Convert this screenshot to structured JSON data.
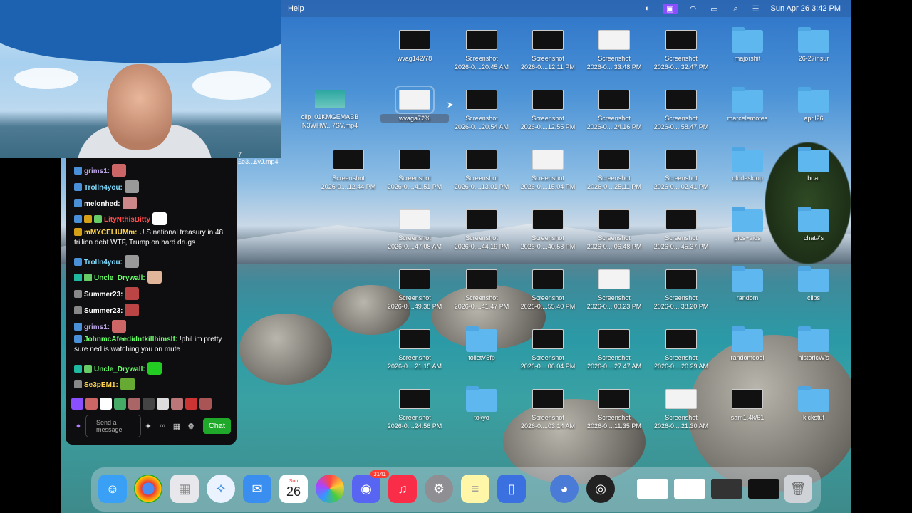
{
  "menubar": {
    "help": "Help",
    "datetime": "Sun Apr 26  3:42 PM"
  },
  "chat": {
    "messages": [
      {
        "user": "grims1:",
        "color": "#b9a3e3",
        "text": ""
      },
      {
        "user": "Trolln4you:",
        "color": "#7fdcff",
        "text": ""
      },
      {
        "user": "melonhed:",
        "color": "#ffffff",
        "text": ""
      },
      {
        "user": "LityNthisBitty",
        "color": "#ff4d4d",
        "text": ""
      },
      {
        "user": "mMYCELIUMm:",
        "color": "#ffd54d",
        "text": "U.S national treasury in 48 trillion debt WTF, Trump on hard drugs"
      },
      {
        "user": "Trolln4you:",
        "color": "#7fdcff",
        "text": ""
      },
      {
        "user": "Uncle_Drywall:",
        "color": "#6cff6c",
        "text": ""
      },
      {
        "user": "Summer23:",
        "color": "#ffffff",
        "text": ""
      },
      {
        "user": "Summer23:",
        "color": "#ffffff",
        "text": ""
      },
      {
        "user": "grims1:",
        "color": "#b9a3e3",
        "text": ""
      },
      {
        "user": "JohnmcAfeedidntkillhimslf:",
        "color": "#6cff6c",
        "text": "!phil im pretty sure ned is watching you on mute"
      },
      {
        "user": "Uncle_Drywall:",
        "color": "#6cff6c",
        "text": ""
      },
      {
        "user": "Se3pEM1:",
        "color": "#ffd54d",
        "text": ""
      }
    ],
    "placeholder": "Send a message",
    "chat_button": "Chat"
  },
  "cam_label": "7\n£e3...£vJ.mp4",
  "desktop_icons": [
    {
      "label": "wvag142/78",
      "type": "thumb"
    },
    {
      "label": "Screenshot\n2026-0....20.45 AM",
      "type": "thumb"
    },
    {
      "label": "Screenshot\n2026-0....12.11 PM",
      "type": "thumb"
    },
    {
      "label": "Screenshot\n2026-0....33.48 PM",
      "type": "thumb"
    },
    {
      "label": "Screenshot\n2026-0....32.47 PM",
      "type": "thumb"
    },
    {
      "label": "majorshit",
      "type": "folder"
    },
    {
      "label": "26-27insur",
      "type": "folder"
    },
    {
      "label": "clip_01KMGEMABB\nN3WHW...7SV.mp4",
      "type": "thumb"
    },
    {
      "label": "wvaga72%",
      "type": "thumb"
    },
    {
      "label": "Screenshot\n2026-0....20.54 AM",
      "type": "thumb"
    },
    {
      "label": "Screenshot\n2026-0....12.55 PM",
      "type": "thumb"
    },
    {
      "label": "Screenshot\n2026-0....24.16 PM",
      "type": "thumb"
    },
    {
      "label": "Screenshot\n2026-0....58.47 PM",
      "type": "thumb"
    },
    {
      "label": "marcelemotes",
      "type": "folder"
    },
    {
      "label": "april26",
      "type": "folder"
    },
    {
      "label": "Screenshot\n2026-0....12.44 PM",
      "type": "thumb"
    },
    {
      "label": "Screenshot\n2026-0....41.51 PM",
      "type": "thumb"
    },
    {
      "label": "Screenshot\n2026-0....13.01 PM",
      "type": "thumb"
    },
    {
      "label": "Screenshot\n2026-0....15.04 PM",
      "type": "thumb"
    },
    {
      "label": "Screenshot\n2026-0....25.11 PM",
      "type": "thumb"
    },
    {
      "label": "Screenshot\n2026-0....02.41 PM",
      "type": "thumb"
    },
    {
      "label": "olddesktop",
      "type": "folder"
    },
    {
      "label": "boat",
      "type": "folder"
    },
    {
      "label": "Screenshot\n2026-0....47.08 AM",
      "type": "thumb"
    },
    {
      "label": "Screenshot\n2026-0....44.19 PM",
      "type": "thumb"
    },
    {
      "label": "Screenshot\n2026-0....40.58 PM",
      "type": "thumb"
    },
    {
      "label": "Screenshot\n2026-0....06.48 PM",
      "type": "thumb"
    },
    {
      "label": "Screenshot\n2026-0....45.37 PM",
      "type": "thumb"
    },
    {
      "label": "pics+vids",
      "type": "folder"
    },
    {
      "label": "chat#'s",
      "type": "folder"
    },
    {
      "label": "Screenshot\n2026-0....49.38 PM",
      "type": "thumb"
    },
    {
      "label": "Screenshot\n2026-0....41.47 PM",
      "type": "thumb"
    },
    {
      "label": "Screenshot\n2026-0....55.40 PM",
      "type": "thumb"
    },
    {
      "label": "Screenshot\n2026-0....00.23 PM",
      "type": "thumb"
    },
    {
      "label": "Screenshot\n2026-0....38.20 PM",
      "type": "thumb"
    },
    {
      "label": "random",
      "type": "folder"
    },
    {
      "label": "clips",
      "type": "folder"
    },
    {
      "label": "Screenshot\n2026-0....21.15 AM",
      "type": "thumb"
    },
    {
      "label": "toiletV5fp",
      "type": "folder"
    },
    {
      "label": "Screenshot\n2026-0....06.04 PM",
      "type": "thumb"
    },
    {
      "label": "Screenshot\n2026-0....27.47 AM",
      "type": "thumb"
    },
    {
      "label": "Screenshot\n2026-0....20.29 AM",
      "type": "thumb"
    },
    {
      "label": "randomcool",
      "type": "folder"
    },
    {
      "label": "historicW's",
      "type": "folder"
    },
    {
      "label": "Screenshot\n2026-0....24.56 PM",
      "type": "thumb"
    },
    {
      "label": "tokyo",
      "type": "folder"
    },
    {
      "label": "Screenshot\n2026-0....03.14 AM",
      "type": "thumb"
    },
    {
      "label": "Screenshot\n2026-0....11.35 PM",
      "type": "thumb"
    },
    {
      "label": "Screenshot\n2026-0....21.30 AM",
      "type": "thumb"
    },
    {
      "label": "sam1.4k/61",
      "type": "thumb"
    },
    {
      "label": "kickstuf",
      "type": "folder"
    }
  ],
  "dock": {
    "calendar_month": "Sun",
    "calendar_day": "26",
    "discord_badge": "3141"
  }
}
